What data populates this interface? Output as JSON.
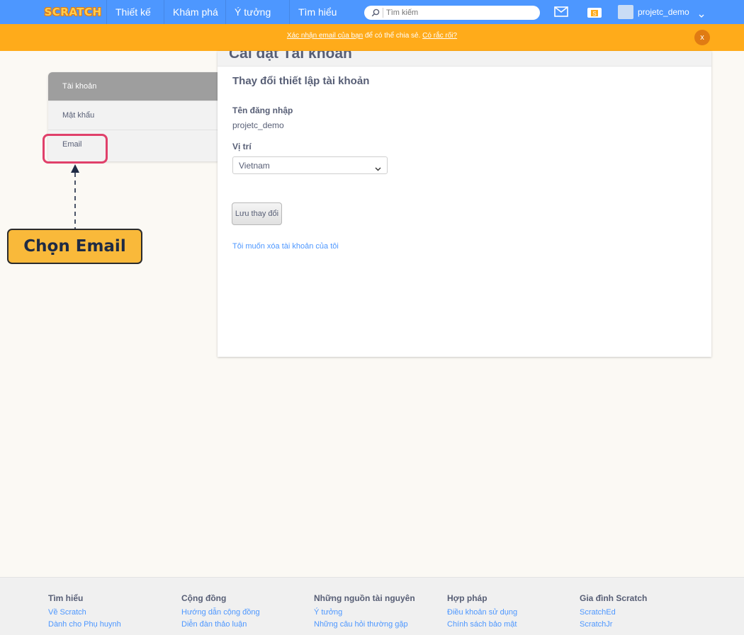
{
  "nav": {
    "logo": "SCRATCH",
    "links": [
      "Thiết kế",
      "Khám phá",
      "Ý tưởng",
      "Tìm hiểu"
    ],
    "search_placeholder": "Tìm kiếm",
    "messages_icon": "envelope-icon",
    "mystuff_icon": "folder-icon",
    "username": "projetc_demo",
    "accent": "#4d97ff"
  },
  "banner": {
    "link1": "Xác nhận email của bạn",
    "text": " để có thể chia sẻ. ",
    "link2": "Có rắc rối?",
    "close": "x",
    "color": "#ffab1a"
  },
  "sidebar": {
    "items": [
      {
        "label": "Tài khoản"
      },
      {
        "label": "Mật khẩu"
      },
      {
        "label": "Email"
      }
    ]
  },
  "panel": {
    "page_title": "Cài đặt Tài khoản",
    "section_title": "Thay đổi thiết lập tài khoản",
    "username_label": "Tên đăng nhập",
    "username_value": "projetc_demo",
    "location_label": "Vị trí",
    "location_value": "Vietnam",
    "save_label": "Lưu thay đổi",
    "delete_link": "Tôi muốn xóa tài khoản của tôi"
  },
  "annotation": {
    "callout": "Chọn Email",
    "highlight_color": "#e0406a"
  },
  "footer": {
    "columns": [
      {
        "title": "Tìm hiểu",
        "links": [
          "Về Scratch",
          "Dành cho Phụ huynh"
        ]
      },
      {
        "title": "Cộng đồng",
        "links": [
          "Hướng dẫn cộng đồng",
          "Diễn đàn thảo luận"
        ]
      },
      {
        "title": "Những nguồn tài nguyên",
        "links": [
          "Ý tưởng",
          "Những câu hỏi thường gặp"
        ]
      },
      {
        "title": "Hợp pháp",
        "links": [
          "Điều khoản sử dụng",
          "Chính sách bảo mật"
        ]
      },
      {
        "title": "Gia đình Scratch",
        "links": [
          "ScratchEd",
          "ScratchJr"
        ]
      }
    ]
  }
}
